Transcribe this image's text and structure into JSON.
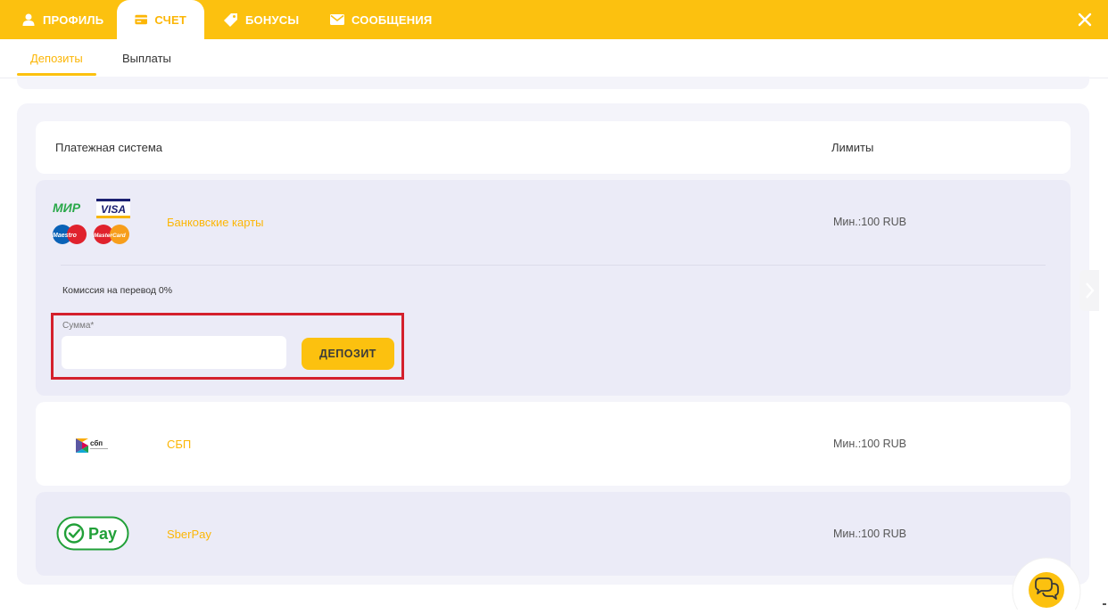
{
  "tabs": [
    {
      "label": "ПРОФИЛЬ",
      "icon": "user-icon"
    },
    {
      "label": "СЧЕТ",
      "icon": "card-icon",
      "active": true
    },
    {
      "label": "БОНУСЫ",
      "icon": "tag-icon"
    },
    {
      "label": "СООБЩЕНИЯ",
      "icon": "envelope-icon"
    }
  ],
  "subtabs": [
    {
      "label": "Депозиты",
      "active": true
    },
    {
      "label": "Выплаты"
    }
  ],
  "table": {
    "col_system": "Платежная система",
    "col_limits": "Лимиты"
  },
  "methods": [
    {
      "name": "Банковские карты",
      "limit": "Мин.:100 RUB",
      "logos": {
        "mir": "МИР",
        "visa": "VISA",
        "maestro": "Maestro",
        "mastercard": "MasterCard"
      },
      "commission": "Комиссия на перевод 0%",
      "amount_label": "Сумма*",
      "amount_value": "",
      "deposit_label": "ДЕПОЗИТ"
    },
    {
      "name": "СБП",
      "limit": "Мин.:100 RUB",
      "logo_text": "сбп"
    },
    {
      "name": "SberPay",
      "limit": "Мин.:100 RUB",
      "logo_text": "Pay"
    }
  ],
  "colors": {
    "accent": "#fcc10f",
    "accent_text": "#fcb606",
    "panel": "#f4f4fa",
    "highlight": "#d4202c",
    "sber_green": "#21a038"
  }
}
